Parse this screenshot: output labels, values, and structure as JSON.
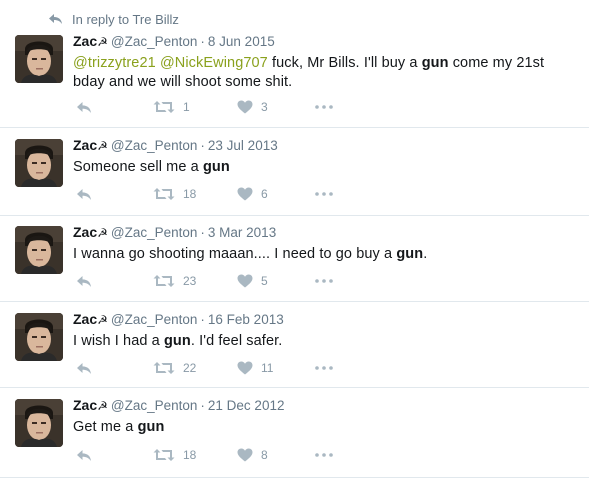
{
  "reply_context": {
    "icon": "reply-arrow-icon",
    "text": "In reply to Tre Billz"
  },
  "tweets": [
    {
      "name": "Zac",
      "name_emoji": "☭",
      "handle": "@Zac_Penton",
      "date": "8 Jun 2015",
      "text_parts": [
        {
          "t": "@trizzytre21",
          "style": "mention"
        },
        {
          "t": " ",
          "style": "plain"
        },
        {
          "t": "@NickEwing707",
          "style": "mention"
        },
        {
          "t": " fuck, Mr Bills. I'll buy a ",
          "style": "plain"
        },
        {
          "t": "gun",
          "style": "bold"
        },
        {
          "t": " come my 21st bday and we will shoot some shit.",
          "style": "plain"
        }
      ],
      "retweets": "1",
      "likes": "3"
    },
    {
      "name": "Zac",
      "name_emoji": "☭",
      "handle": "@Zac_Penton",
      "date": "23 Jul 2013",
      "text_parts": [
        {
          "t": "Someone sell me a ",
          "style": "plain"
        },
        {
          "t": "gun",
          "style": "bold"
        }
      ],
      "retweets": "18",
      "likes": "6"
    },
    {
      "name": "Zac",
      "name_emoji": "☭",
      "handle": "@Zac_Penton",
      "date": "3 Mar 2013",
      "text_parts": [
        {
          "t": "I wanna go shooting maaan.... I need to go buy a ",
          "style": "plain"
        },
        {
          "t": "gun",
          "style": "bold"
        },
        {
          "t": ".",
          "style": "plain"
        }
      ],
      "retweets": "23",
      "likes": "5"
    },
    {
      "name": "Zac",
      "name_emoji": "☭",
      "handle": "@Zac_Penton",
      "date": "16 Feb 2013",
      "text_parts": [
        {
          "t": "I wish I had a ",
          "style": "plain"
        },
        {
          "t": "gun",
          "style": "bold"
        },
        {
          "t": ". I'd feel safer.",
          "style": "plain"
        }
      ],
      "retweets": "22",
      "likes": "11"
    },
    {
      "name": "Zac",
      "name_emoji": "☭",
      "handle": "@Zac_Penton",
      "date": "21 Dec 2012",
      "text_parts": [
        {
          "t": "Get me a ",
          "style": "plain"
        },
        {
          "t": "gun",
          "style": "bold"
        }
      ],
      "retweets": "18",
      "likes": "8"
    }
  ],
  "icons": {
    "reply": "reply-icon",
    "retweet": "retweet-icon",
    "like": "heart-icon",
    "more": "more-icon"
  },
  "colors": {
    "mention": "#8aa11d",
    "muted": "#657786",
    "action": "#8899a6",
    "divider": "#e1e8ed"
  }
}
